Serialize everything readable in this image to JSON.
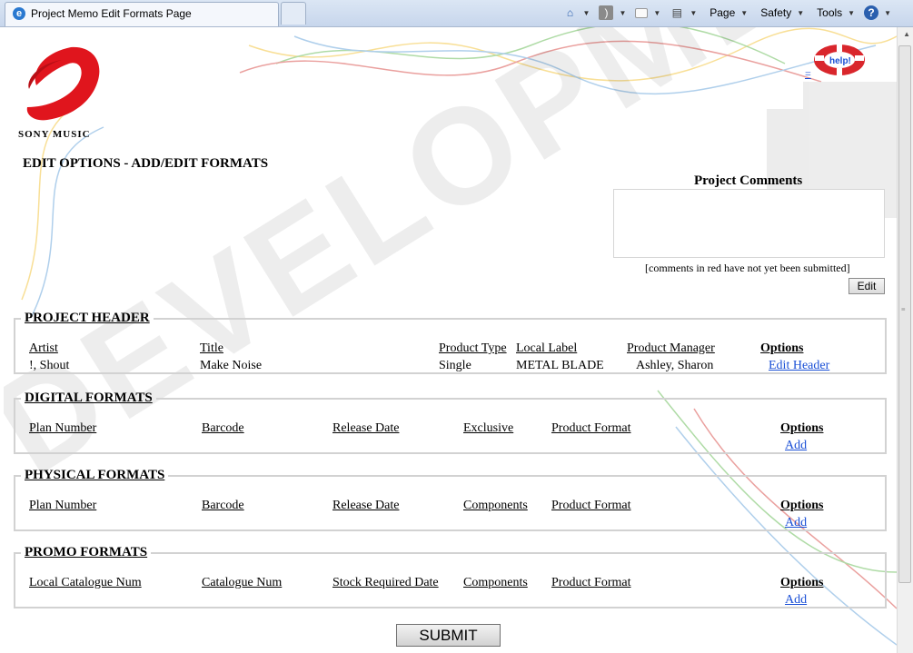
{
  "browser": {
    "tab_title": "Project Memo Edit Formats Page",
    "commands": {
      "page": "Page",
      "safety": "Safety",
      "tools": "Tools"
    }
  },
  "header": {
    "logo_text": "SONY MUSIC",
    "help_link": "=",
    "help_icon_text": "help!",
    "page_title": "EDIT OPTIONS - ADD/EDIT FORMATS",
    "watermark": "DEVELOPMENT"
  },
  "comments": {
    "title": "Project Comments",
    "note": "[comments in red have not yet been submitted]",
    "edit_label": "Edit"
  },
  "project_header": {
    "legend": "PROJECT HEADER",
    "columns": [
      "Artist",
      "Title",
      "Product Type",
      "Local Label",
      "Product Manager"
    ],
    "options_label": "Options",
    "row": [
      "!, Shout",
      "Make Noise",
      "Single",
      "METAL BLADE",
      "Ashley, Sharon"
    ],
    "action": "Edit Header"
  },
  "digital_formats": {
    "legend": "DIGITAL FORMATS",
    "columns": [
      "Plan Number",
      "Barcode",
      "Release Date",
      "Exclusive",
      "Product Format"
    ],
    "options_label": "Options",
    "action": "Add"
  },
  "physical_formats": {
    "legend": "PHYSICAL FORMATS",
    "columns": [
      "Plan Number",
      "Barcode",
      "Release Date",
      "Components",
      "Product Format"
    ],
    "options_label": "Options",
    "action": "Add"
  },
  "promo_formats": {
    "legend": "PROMO FORMATS",
    "columns": [
      "Local Catalogue Num",
      "Catalogue Num",
      "Stock Required Date",
      "Components",
      "Product Format"
    ],
    "options_label": "Options",
    "action": "Add"
  },
  "submit_label": "SUBMIT",
  "colors": {
    "link": "#1a4fd6",
    "logo_red": "#e0151d",
    "border": "#d2d2d2"
  }
}
